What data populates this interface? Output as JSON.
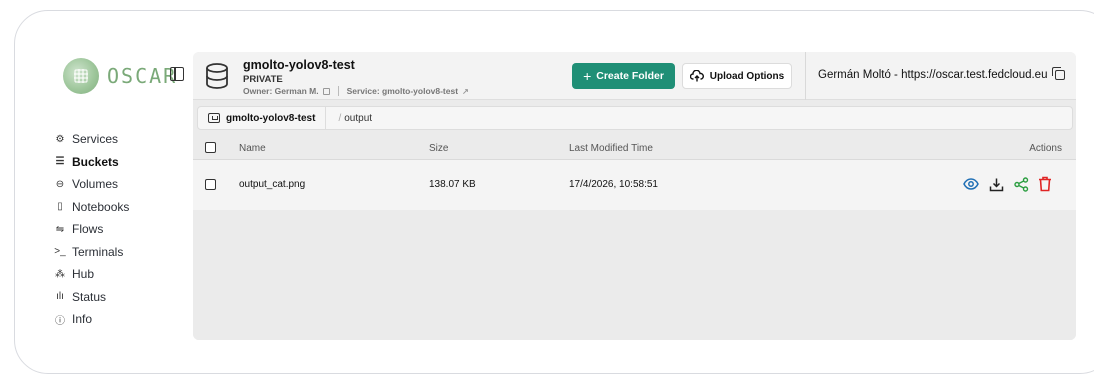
{
  "app": {
    "logo_text": "OSCAR"
  },
  "sidebar": {
    "items": [
      {
        "label": "Services",
        "icon": "services-icon",
        "active": false
      },
      {
        "label": "Buckets",
        "icon": "bucket-icon",
        "active": true
      },
      {
        "label": "Volumes",
        "icon": "volume-icon",
        "active": false
      },
      {
        "label": "Notebooks",
        "icon": "notebook-icon",
        "active": false
      },
      {
        "label": "Flows",
        "icon": "flows-icon",
        "active": false
      },
      {
        "label": "Terminals",
        "icon": "terminal-icon",
        "active": false
      },
      {
        "label": "Hub",
        "icon": "hub-icon",
        "active": false
      },
      {
        "label": "Status",
        "icon": "status-icon",
        "active": false
      },
      {
        "label": "Info",
        "icon": "info-icon",
        "active": false
      }
    ]
  },
  "header": {
    "bucket_name": "gmolto-yolov8-test",
    "visibility": "PRIVATE",
    "owner": "Owner: German M.",
    "service": "Service: gmolto-yolov8-test",
    "create_folder_label": "Create Folder",
    "upload_label": "Upload Options",
    "user_label": "Germán Moltó - https://oscar.test.fedcloud.eu"
  },
  "breadcrumb": {
    "root": "gmolto-yolov8-test",
    "current": "output"
  },
  "table": {
    "columns": {
      "name": "Name",
      "size": "Size",
      "modified": "Last Modified Time",
      "actions": "Actions"
    },
    "rows": [
      {
        "name": "output_cat.png",
        "size": "138.07 KB",
        "modified": "17/4/2026, 10:58:51"
      }
    ]
  },
  "colors": {
    "accent": "#1f8f76",
    "danger": "#e02424",
    "logo": "#7aa978"
  }
}
